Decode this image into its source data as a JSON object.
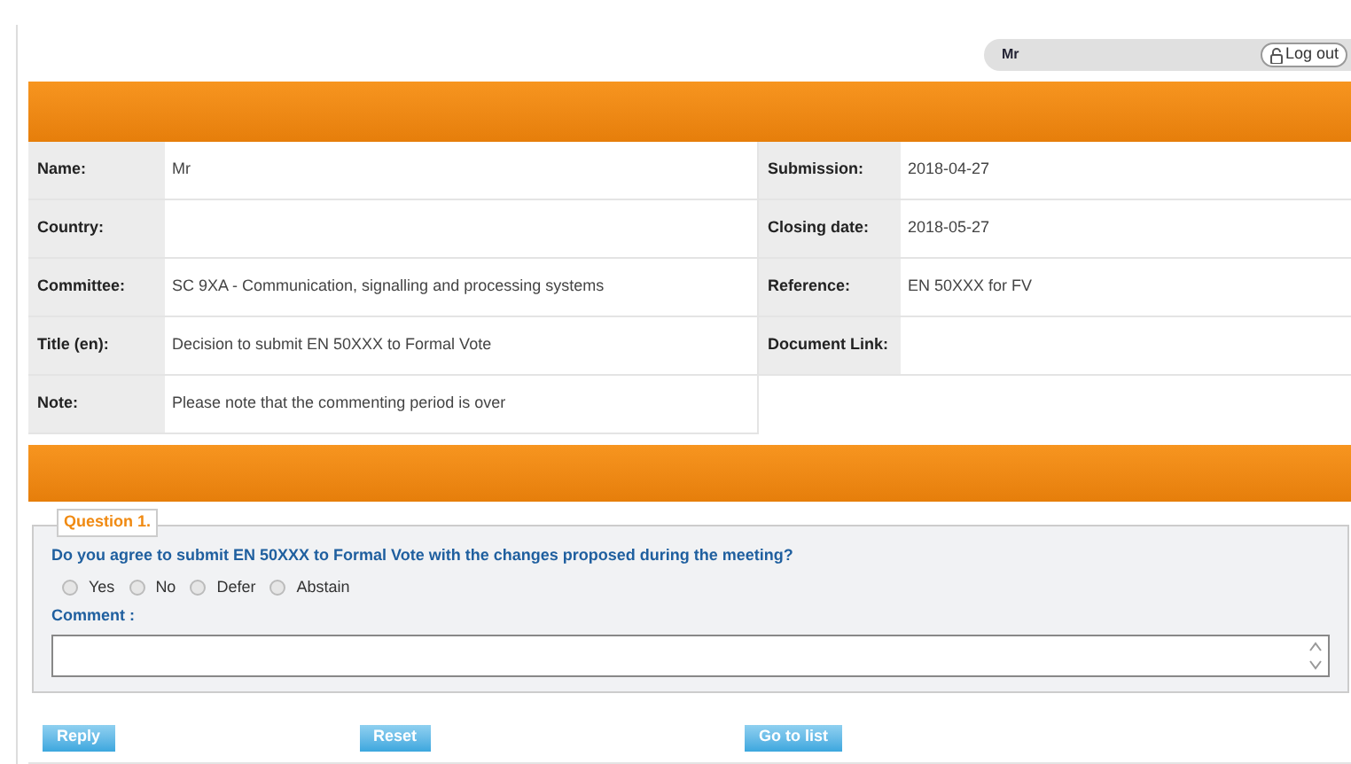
{
  "user_bar": {
    "user": "Mr",
    "logout": "Log out"
  },
  "details_left": [
    {
      "label": "Name:",
      "value": "Mr"
    },
    {
      "label": "Country:"
    },
    {
      "label": "Committee:",
      "value": "SC 9XA - Communication, signalling and processing systems"
    },
    {
      "label": "Title (en):",
      "value": "Decision to submit EN 50XXX to Formal Vote"
    },
    {
      "label": "Note:",
      "value": "Please note that the commenting period is over"
    }
  ],
  "details_right": [
    {
      "label": "Submission:",
      "value": "2018-04-27"
    },
    {
      "label": "Closing date:",
      "value": "2018-05-27"
    },
    {
      "label": "Reference:",
      "value": "EN 50XXX for FV"
    },
    {
      "label": "Document Link:"
    }
  ],
  "question": {
    "legend": "Question 1.",
    "text": "Do you agree to submit EN 50XXX to Formal Vote with the changes proposed during the meeting?",
    "options": [
      {
        "label": "Yes",
        "selected": false
      },
      {
        "label": "No",
        "selected": false
      },
      {
        "label": "Defer",
        "selected": false
      },
      {
        "label": "Abstain",
        "selected": false
      }
    ],
    "comment_label": "Comment :"
  },
  "buttons": [
    "Reply",
    "Reset",
    "Go to list"
  ]
}
